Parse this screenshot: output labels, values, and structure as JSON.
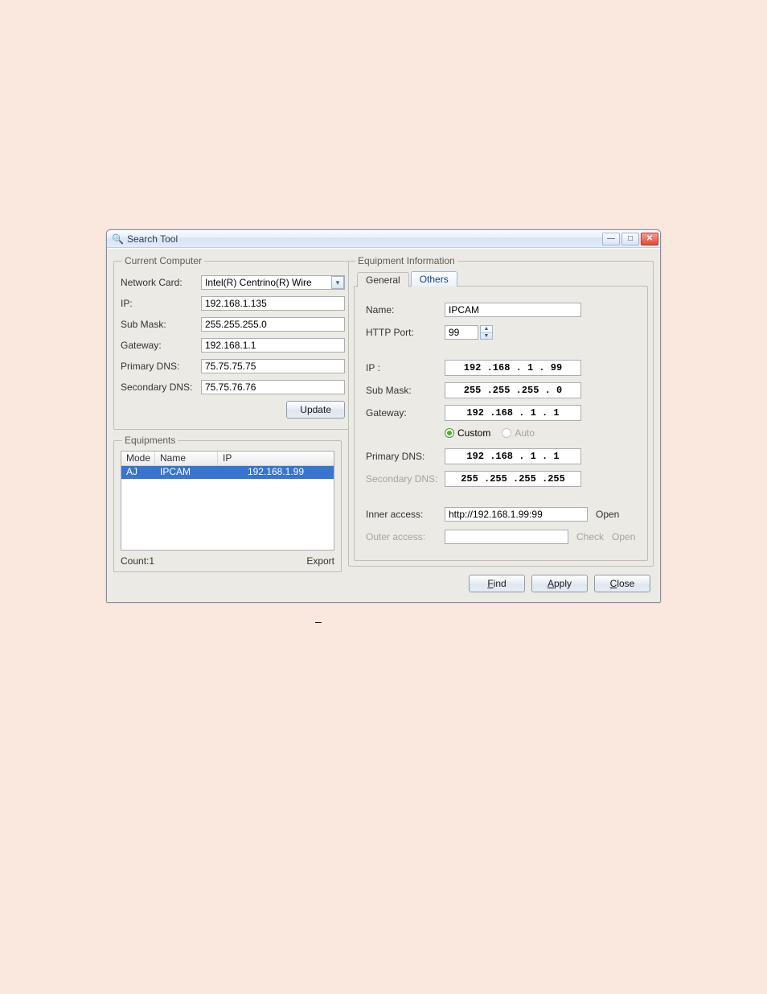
{
  "window": {
    "title": "Search Tool"
  },
  "computer": {
    "legend": "Current Computer",
    "labels": {
      "nic": "Network Card:",
      "ip": "IP:",
      "mask": "Sub Mask:",
      "gw": "Gateway:",
      "dns1": "Primary DNS:",
      "dns2": "Secondary DNS:"
    },
    "values": {
      "nic": "Intel(R) Centrino(R) Wire",
      "ip": "192.168.1.135",
      "mask": "255.255.255.0",
      "gw": "192.168.1.1",
      "dns1": "75.75.75.75",
      "dns2": "75.75.76.76"
    },
    "update_btn": "Update"
  },
  "equipments": {
    "legend": "Equipments",
    "cols": {
      "mode": "Mode",
      "name": "Name",
      "ip": "IP"
    },
    "rows": [
      {
        "mode": "AJ",
        "name": "IPCAM",
        "ip": "192.168.1.99"
      }
    ],
    "count_label": "Count:",
    "count": "1",
    "export": "Export"
  },
  "info": {
    "legend": "Equipment Information",
    "tabs": {
      "general": "General",
      "others": "Others"
    },
    "labels": {
      "name": "Name:",
      "port": "HTTP Port:",
      "ip": "IP  :",
      "mask": "Sub Mask:",
      "gw": "Gateway:",
      "dns1": "Primary DNS:",
      "dns2": "Secondary DNS:",
      "inner": "Inner access:",
      "outer": "Outer access:"
    },
    "values": {
      "name": "IPCAM",
      "port": "99",
      "ip": "192 .168 .  1  . 99",
      "mask": "255 .255 .255 .  0",
      "gw": "192 .168 .  1  .  1",
      "dns1": "192 .168 .  1  .  1",
      "dns2": "255 .255 .255 .255",
      "inner": "http://192.168.1.99:99"
    },
    "radio": {
      "custom": "Custom",
      "auto": "Auto"
    },
    "links": {
      "open": "Open",
      "check": "Check"
    }
  },
  "buttons": {
    "find": "Find",
    "apply": "Apply",
    "close": "Close"
  },
  "dash": "–"
}
